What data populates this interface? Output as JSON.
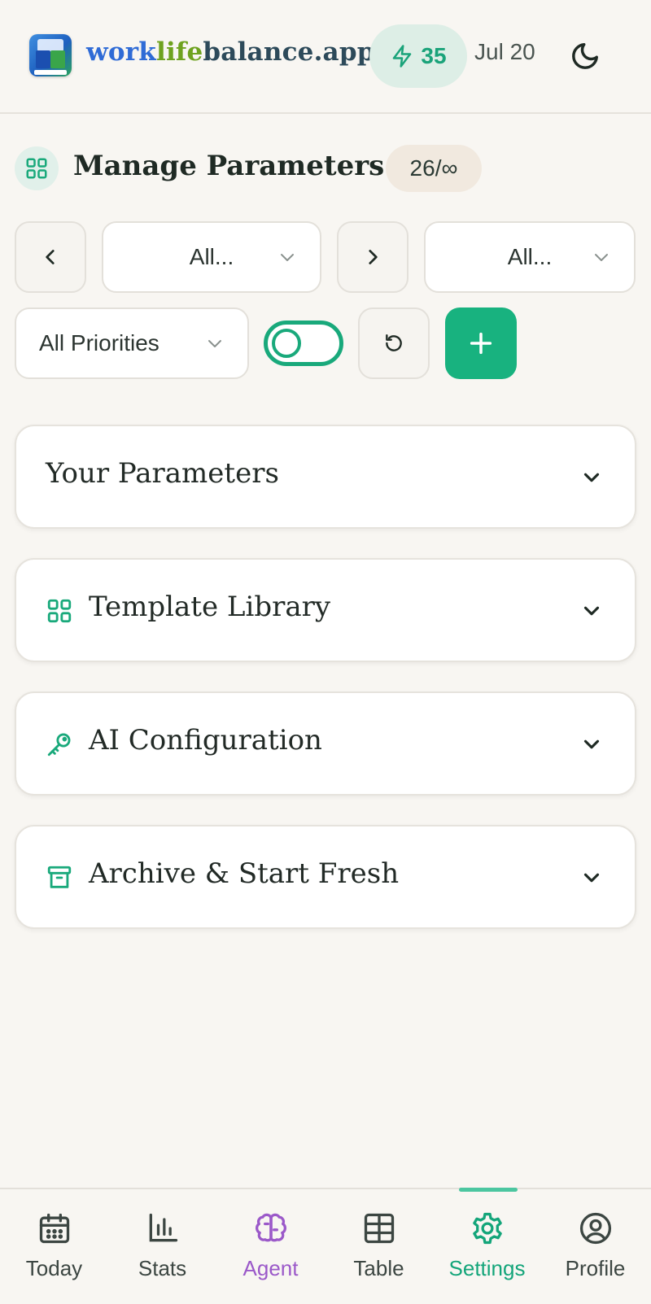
{
  "header": {
    "brand_part1": "work",
    "brand_part2": "life",
    "brand_part3": "balance.app",
    "energy_count": "35",
    "date": "Jul 20",
    "icons": {
      "logo": "app-logo",
      "energy": "lightning-icon",
      "theme": "moon-icon"
    }
  },
  "title": {
    "text": "Manage Parameters",
    "count": "26/∞",
    "icon": "grid-icon"
  },
  "filters": {
    "category_select": "All...",
    "second_select": "All...",
    "priority_select": "All Priorities",
    "toggle_on": false
  },
  "sections": [
    {
      "title": "Your Parameters",
      "icon": null
    },
    {
      "title": "Template Library",
      "icon": "grid-icon"
    },
    {
      "title": "AI Configuration",
      "icon": "key-icon"
    },
    {
      "title": "Archive & Start Fresh",
      "icon": "archive-icon"
    }
  ],
  "bottom_nav": [
    {
      "label": "Today",
      "icon": "calendar-icon"
    },
    {
      "label": "Stats",
      "icon": "bar-chart-icon"
    },
    {
      "label": "Agent",
      "icon": "brain-icon"
    },
    {
      "label": "Table",
      "icon": "table-icon"
    },
    {
      "label": "Settings",
      "icon": "gear-icon",
      "active": true
    },
    {
      "label": "Profile",
      "icon": "user-circle-icon"
    }
  ],
  "colors": {
    "accent": "#18b27f",
    "agent": "#9b59c9",
    "background": "#f8f6f2"
  }
}
